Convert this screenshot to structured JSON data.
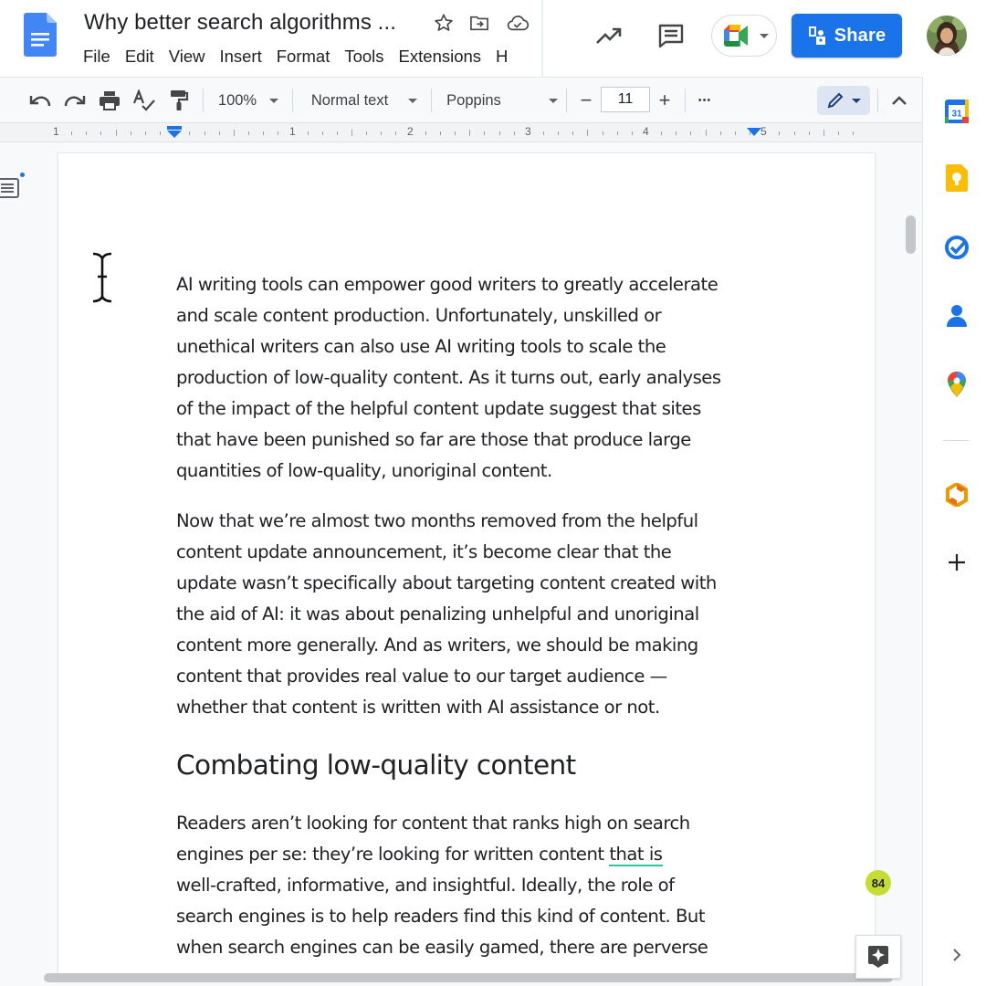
{
  "app": {
    "doc_title": "Why better search algorithms ...",
    "menu": [
      "File",
      "Edit",
      "View",
      "Insert",
      "Format",
      "Tools",
      "Extensions",
      "H"
    ],
    "share_label": "Share",
    "colors": {
      "accent": "#1a73e8",
      "grammar_underline": "#34c49a",
      "badge": "#c6dc32"
    }
  },
  "toolbar": {
    "zoom": "100%",
    "style": "Normal text",
    "font": "Poppins",
    "font_size": "11",
    "minus": "−",
    "plus": "+",
    "more": "•••",
    "mode": "editing"
  },
  "ruler": {
    "labels": [
      "1",
      "1",
      "2",
      "3",
      "4",
      "5"
    ]
  },
  "document": {
    "para1": [
      "AI writing tools can empower good writers to greatly accelerate",
      "and scale content production. Unfortunately, unskilled or",
      "unethical writers can also use AI writing tools to scale the",
      "production of low-quality content. As it turns out, early analyses",
      "of the impact of the helpful content update suggest that sites",
      "that have been punished so far are those that produce large",
      "quantities of low-quality, unoriginal content."
    ],
    "para2": [
      "Now that we’re almost two months removed from the helpful",
      "content update announcement, it’s become clear that the",
      "update wasn’t specifically about targeting content created with",
      "the aid of AI: it was about penalizing unhelpful and unoriginal",
      "content more generally. And as writers, we should be making",
      "content that provides real value to our target audience —",
      "whether that content is written with AI assistance or not."
    ],
    "heading": "Combating low-quality content",
    "para3": {
      "line1": "Readers aren’t looking for content that ranks high on search",
      "line2_before": "engines per se: they’re looking for written content ",
      "line2_flagged": "that is",
      "line3": "well-crafted, informative, and insightful. Ideally, the role of",
      "line4": "search engines is to help readers find this kind of content. But",
      "line5": "when search engines can be easily gamed, there are perverse"
    },
    "word_badge": "84"
  },
  "side_panel": {
    "icons": [
      "calendar-icon",
      "keep-icon",
      "tasks-icon",
      "contacts-icon",
      "maps-icon",
      "addon-icon",
      "add-icon",
      "expand-icon"
    ],
    "calendar_day": "31"
  }
}
